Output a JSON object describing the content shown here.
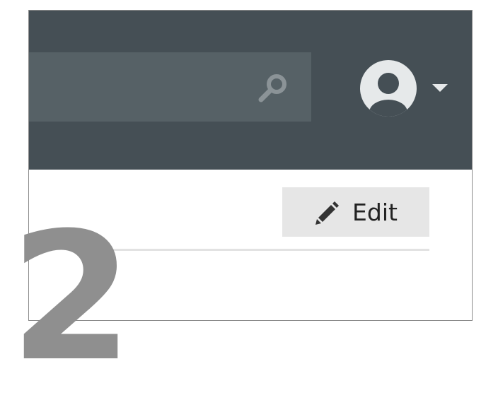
{
  "header": {
    "background_color": "#454f55",
    "search": {
      "icon": "search-icon",
      "field_color": "#566166"
    },
    "user_menu": {
      "avatar_icon": "user-avatar-icon",
      "caret_icon": "caret-down-icon"
    }
  },
  "content": {
    "edit_button": {
      "label": "Edit",
      "icon": "pencil-icon"
    }
  },
  "callout": {
    "step_number": "2",
    "color": "#8f8f8f"
  }
}
